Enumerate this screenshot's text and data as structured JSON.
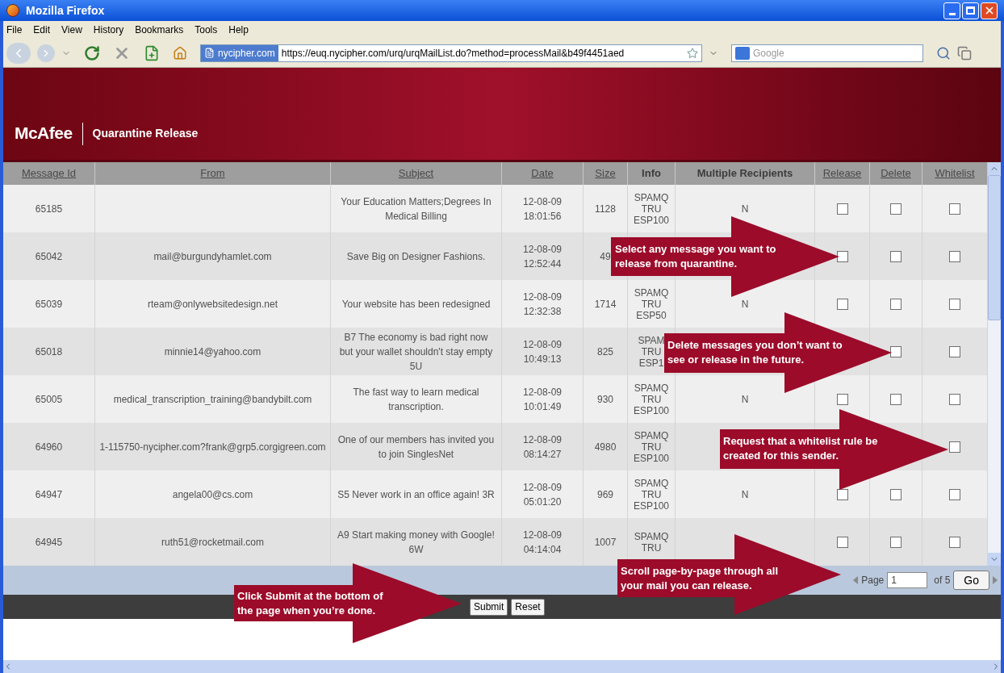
{
  "window": {
    "title": "Mozilla Firefox"
  },
  "menu": [
    "File",
    "Edit",
    "View",
    "History",
    "Bookmarks",
    "Tools",
    "Help"
  ],
  "toolbar": {
    "site": "nycipher.com",
    "url": "https://euq.nycipher.com/urq/urqMailList.do?method=processMail&b49f4451aed",
    "search_placeholder": "Google"
  },
  "banner": {
    "logo": "McAfee",
    "title": "Quarantine Release"
  },
  "table": {
    "columns": [
      {
        "label": "Message Id",
        "link": true
      },
      {
        "label": "From",
        "link": true
      },
      {
        "label": "Subject",
        "link": true
      },
      {
        "label": "Date",
        "link": true
      },
      {
        "label": "Size",
        "link": true
      },
      {
        "label": "Info",
        "link": false
      },
      {
        "label": "Multiple Recipients",
        "link": false
      },
      {
        "label": "Release",
        "link": true
      },
      {
        "label": "Delete",
        "link": true
      },
      {
        "label": "Whitelist",
        "link": true
      }
    ],
    "rows": [
      {
        "id": "65185",
        "subject": "Your Education Matters;Degrees In Medical Billing",
        "date": "12-08-09",
        "time": "18:01:56",
        "size": "1128",
        "info": [
          "SPAMQ",
          "TRU",
          "ESP100"
        ],
        "recipients": "N",
        "release": {
          "checked": false
        },
        "delete": {
          "checked": false
        },
        "whitelist": {
          "checked": false
        }
      },
      {
        "id": "65042",
        "from": "mail@burgundyhamlet.com",
        "subject": "Save Big on Designer Fashions.",
        "date": "12-08-09",
        "time": "12:52:44",
        "size": "49",
        "release": {
          "checked": false
        },
        "delete": {
          "checked": false
        },
        "whitelist": {
          "checked": false
        }
      },
      {
        "id": "65039",
        "from": "rteam@onlywebsitedesign.net",
        "subject": "Your website has been redesigned",
        "date": "12-08-09",
        "time": "12:32:38",
        "size": "1714",
        "info": [
          "SPAMQ",
          "TRU",
          "ESP50"
        ],
        "recipients": "N",
        "release": {
          "checked": false
        },
        "delete": {
          "checked": false
        },
        "whitelist": {
          "checked": false
        }
      },
      {
        "id": "65018",
        "from": "minnie14@yahoo.com",
        "subject": "B7 The economy is bad right now but your wallet shouldn't stay empty 5U",
        "date": "12-08-09",
        "time": "10:49:13",
        "size": "825",
        "info": [
          "SPAM",
          "TRU",
          "ESP1"
        ],
        "delete": {
          "checked": false
        },
        "whitelist": {
          "checked": false
        }
      },
      {
        "id": "65005",
        "from": "medical_transcription_training@bandybilt.com",
        "subject": "The fast way to learn medical transcription.",
        "date": "12-08-09",
        "time": "10:01:49",
        "size": "930",
        "info": [
          "SPAMQ",
          "TRU",
          "ESP100"
        ],
        "recipients": "N",
        "release": {
          "checked": false
        },
        "delete": {
          "checked": false
        },
        "whitelist": {
          "checked": false
        }
      },
      {
        "id": "64960",
        "from": "1-115750-nycipher.com?frank@grp5.corgigreen.com",
        "subject": "One of our members has invited you to join SinglesNet",
        "date": "12-08-09",
        "time": "08:14:27",
        "size": "4980",
        "info": [
          "SPAMQ",
          "TRU",
          "ESP100"
        ],
        "whitelist": {
          "checked": false
        }
      },
      {
        "id": "64947",
        "from": "angela00@cs.com",
        "subject": "S5 Never work in an office again! 3R",
        "date": "12-08-09",
        "time": "05:01:20",
        "size": "969",
        "info": [
          "SPAMQ",
          "TRU",
          "ESP100"
        ],
        "recipients": "N",
        "release": {
          "checked": false
        },
        "delete": {
          "checked": false
        },
        "whitelist": {
          "checked": false
        }
      },
      {
        "id": "64945",
        "from": "ruth51@rocketmail.com",
        "subject": "A9 Start making money with Google! 6W",
        "date": "12-08-09",
        "time": "04:14:04",
        "size": "1007",
        "info": [
          "SPAMQ",
          "TRU"
        ],
        "release": {
          "checked": false
        },
        "delete": {
          "checked": false
        },
        "whitelist": {
          "checked": false
        }
      }
    ]
  },
  "pager": {
    "label": "Page",
    "page": "1",
    "of": "of 5",
    "go": "Go"
  },
  "buttons": [
    "Submit",
    "Reset"
  ],
  "callouts": [
    "Select any message you want to release from quarantine.",
    "Delete messages you don’t want to see or release in the future.",
    "Request that a whitelist rule be created for this sender.",
    "Scroll page-by-page through all your mail you can release.",
    "Click Submit at the bottom of the page when you’re done."
  ]
}
